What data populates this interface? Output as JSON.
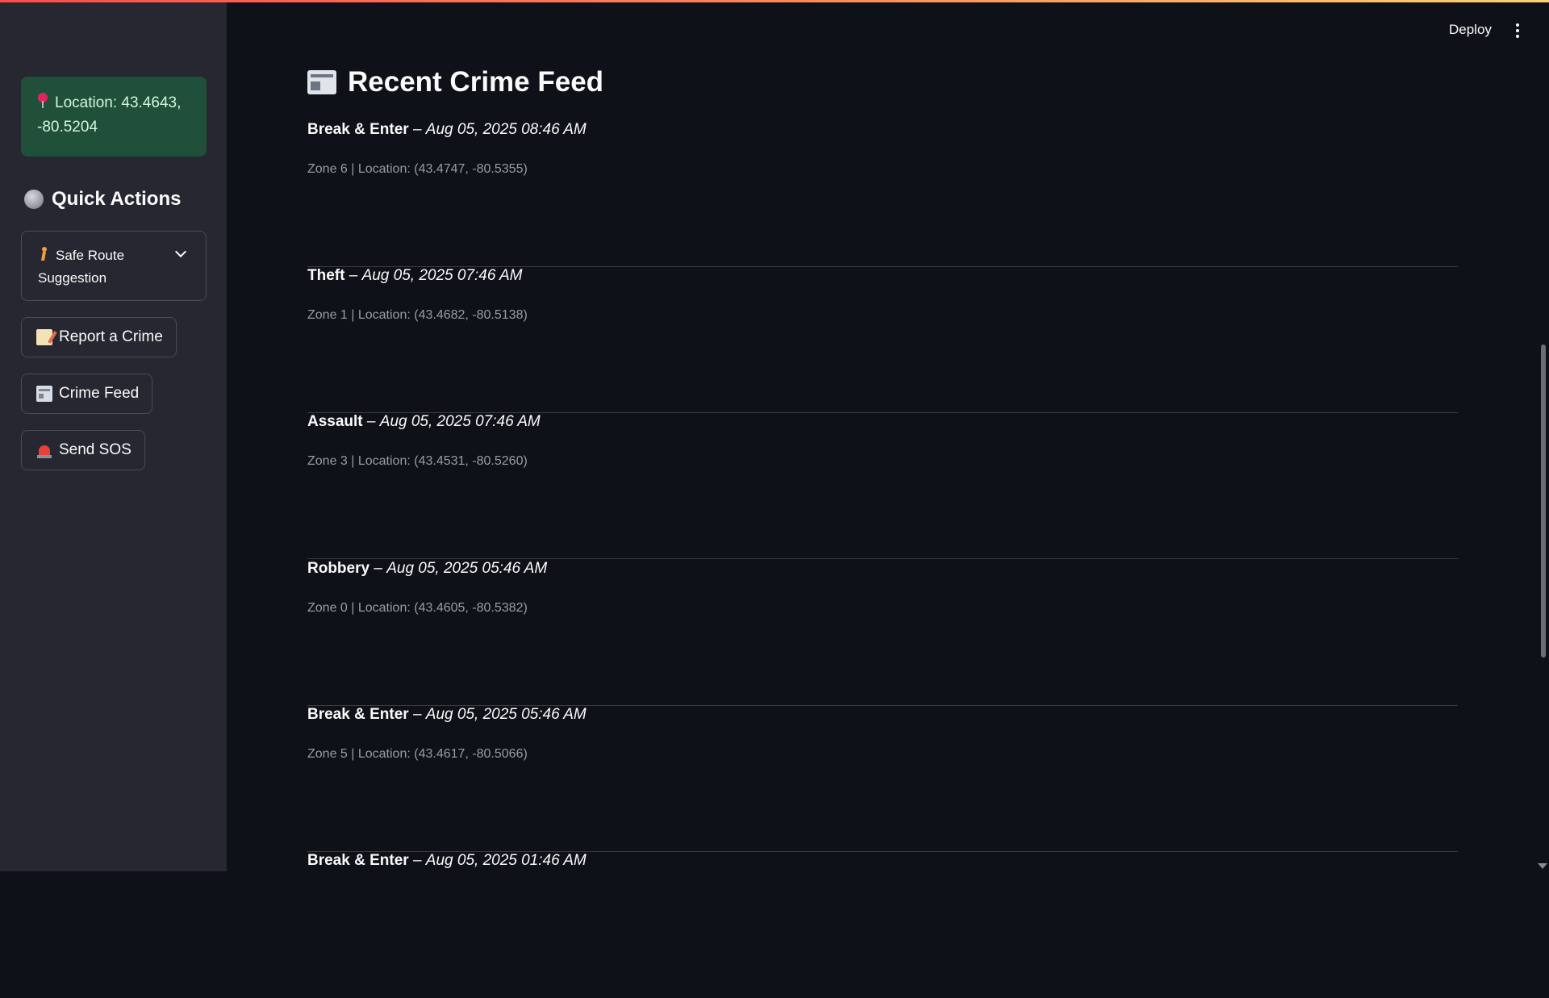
{
  "header": {
    "deploy_label": "Deploy",
    "menu_icon": "kebab-menu-icon"
  },
  "sidebar": {
    "location_text": "Location: 43.4643, -80.5204",
    "location_icon": "pin-icon",
    "quick_actions_heading": "Quick Actions",
    "safe_route_label": "Safe Route Suggestion",
    "buttons": [
      {
        "label": "Report a Crime",
        "icon": "memo-icon"
      },
      {
        "label": "Crime Feed",
        "icon": "newspaper-icon"
      },
      {
        "label": "Send SOS",
        "icon": "siren-icon"
      }
    ]
  },
  "main": {
    "title": "Recent Crime Feed",
    "feed": [
      {
        "type": "Break & Enter",
        "time": "Aug 05, 2025 08:46 AM",
        "details": "Zone 6 | Location: (43.4747, -80.5355)"
      },
      {
        "type": "Theft",
        "time": "Aug 05, 2025 07:46 AM",
        "details": "Zone 1 | Location: (43.4682, -80.5138)"
      },
      {
        "type": "Assault",
        "time": "Aug 05, 2025 07:46 AM",
        "details": "Zone 3 | Location: (43.4531, -80.5260)"
      },
      {
        "type": "Robbery",
        "time": "Aug 05, 2025 05:46 AM",
        "details": "Zone 0 | Location: (43.4605, -80.5382)"
      },
      {
        "type": "Break & Enter",
        "time": "Aug 05, 2025 05:46 AM",
        "details": "Zone 5 | Location: (43.4617, -80.5066)"
      },
      {
        "type": "Break & Enter",
        "time": "Aug 05, 2025 01:46 AM",
        "details": ""
      }
    ]
  },
  "colors": {
    "background": "#0e1117",
    "sidebar": "#262730",
    "location_box": "#21503a",
    "accent_gradient_start": "#ff4b4b",
    "accent_gradient_end": "#fdd26e"
  }
}
